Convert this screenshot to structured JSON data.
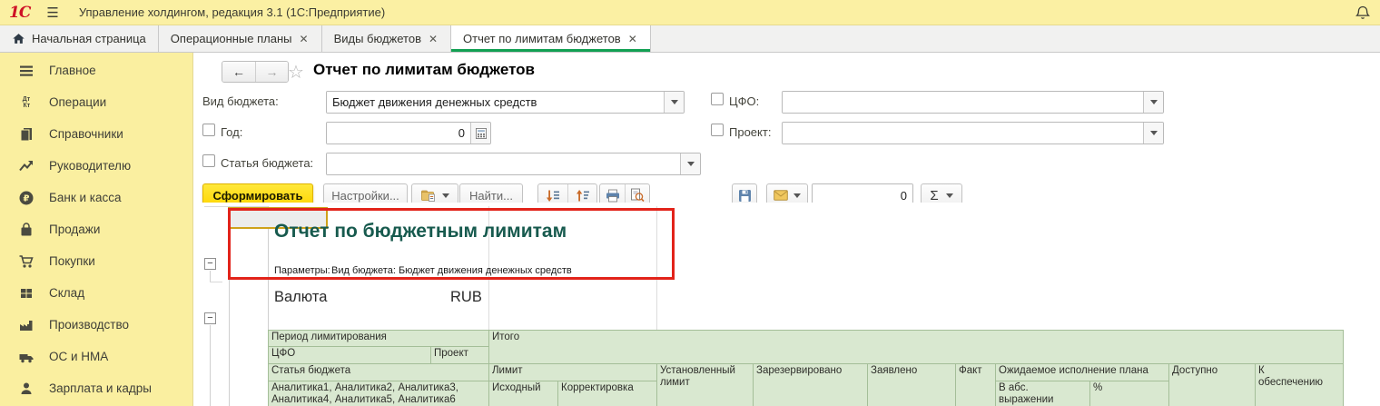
{
  "colors": {
    "topbar_bg": "#FBF0A3",
    "active_tab_underline": "#12A053",
    "report_title_green": "#175A4E",
    "table_header_bg": "#D9E8D0",
    "table_border": "#A4BE98",
    "annotation_red": "#E2231A",
    "generate_button_yellow": "#FFD602"
  },
  "app": {
    "logo": "1С",
    "title": "Управление холдингом, редакция 3.1  (1С:Предприятие)"
  },
  "tabs": [
    {
      "label": "Начальная страница"
    },
    {
      "label": "Операционные планы",
      "close": "✕"
    },
    {
      "label": "Виды бюджетов",
      "close": "✕"
    },
    {
      "label": "Отчет по лимитам бюджетов",
      "close": "✕"
    }
  ],
  "sidebar": {
    "items": [
      {
        "icon": "menu-icon",
        "label": "Главное"
      },
      {
        "icon": "debit-credit-icon",
        "label": "Операции",
        "dt": "Дт",
        "kt": "Кт"
      },
      {
        "icon": "books-icon",
        "label": "Справочники"
      },
      {
        "icon": "trend-icon",
        "label": "Руководителю"
      },
      {
        "icon": "ruble-icon",
        "label": "Банк и касса",
        "glyph": "₽"
      },
      {
        "icon": "bag-icon",
        "label": "Продажи"
      },
      {
        "icon": "cart-icon",
        "label": "Покупки"
      },
      {
        "icon": "grid-icon",
        "label": "Склад"
      },
      {
        "icon": "factory-icon",
        "label": "Производство"
      },
      {
        "icon": "truck-icon",
        "label": "ОС и НМА"
      },
      {
        "icon": "person-icon",
        "label": "Зарплата и кадры"
      }
    ]
  },
  "page": {
    "title": "Отчет по лимитам бюджетов"
  },
  "filters": {
    "budget_type": {
      "label": "Вид бюджета:",
      "value": "Бюджет движения денежных средств"
    },
    "year": {
      "label": "Год:",
      "value": "0",
      "checked": false
    },
    "budget_item": {
      "label": "Статья бюджета:",
      "value": "",
      "checked": false
    },
    "cfo": {
      "label": "ЦФО:",
      "value": "",
      "checked": false
    },
    "project": {
      "label": "Проект:",
      "value": "",
      "checked": false
    }
  },
  "toolbar": {
    "generate_label": "Сформировать",
    "settings_label": "Настройки...",
    "find_label": "Найти...",
    "counter_value": "0",
    "sigma": "Σ"
  },
  "report": {
    "title": "Отчет по бюджетным лимитам",
    "params_label": "Параметры:",
    "params_value": "Вид бюджета: Бюджет движения денежных средств",
    "currency_label": "Валюта",
    "currency_value": "RUB",
    "group_collapse": "−",
    "columns": {
      "period": "Период лимитирования",
      "total": "Итого",
      "cfo": "ЦФО",
      "project": "Проект",
      "budget_item": "Статья бюджета",
      "limit": "Лимит",
      "set_limit": "Установленный лимит",
      "reserved": "Зарезервировано",
      "declared": "Заявлено",
      "fact": "Факт",
      "expected": "Ожидаемое исполнение плана",
      "available": "Доступно",
      "to_provide": "К обеспечению",
      "analytics": "Аналитика1, Аналитика2, Аналитика3, Аналитика4, Аналитика5, Аналитика6",
      "initial": "Исходный",
      "correction": "Корректировка",
      "abs": "В абс. выражении",
      "percent": "%"
    }
  }
}
